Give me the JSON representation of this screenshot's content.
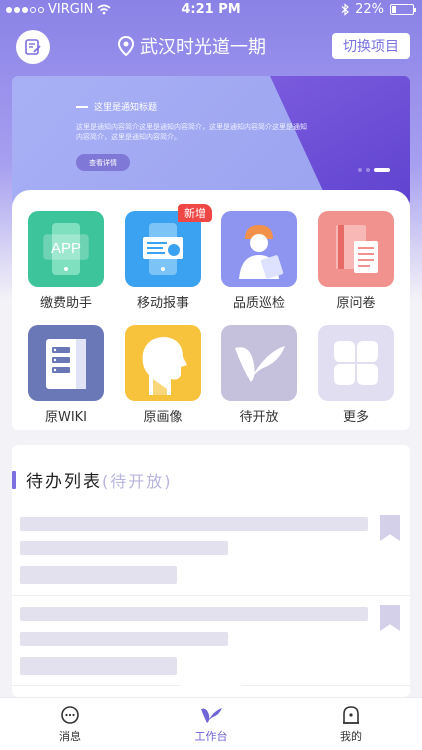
{
  "status_bar": {
    "carrier": "VIRGIN",
    "time": "4:21 PM",
    "battery": "22%"
  },
  "header": {
    "project_name": "武汉时光道一期",
    "switch_button": "切换项目"
  },
  "banner": {
    "title": "这里是通知标题",
    "text": "这里是通知内容简介这里是通知内容简介，这里是通知内容简介这里是通知内容简介，这里是通知内容简介。",
    "details_button": "查看详情",
    "pages": 3,
    "active_page": 3
  },
  "apps": [
    {
      "label": "缴费助手",
      "icon": "app-phone-icon",
      "color": "#3dc49a"
    },
    {
      "label": "移动报事",
      "icon": "mobile-report-icon",
      "color": "#3aa2f0",
      "badge": "新增"
    },
    {
      "label": "品质巡检",
      "icon": "inspector-icon",
      "color": "#8d95f0"
    },
    {
      "label": "原问卷",
      "icon": "questionnaire-icon",
      "color": "#f2928f"
    },
    {
      "label": "原WIKI",
      "icon": "wiki-book-icon",
      "color": "#6a78b8"
    },
    {
      "label": "原画像",
      "icon": "portrait-head-icon",
      "color": "#f7c33d"
    },
    {
      "label": "待开放",
      "icon": "brand-logo-icon",
      "color": "#c5c1dc"
    },
    {
      "label": "更多",
      "icon": "more-clover-icon",
      "color": "#e1def2"
    }
  ],
  "todo": {
    "title": "待办列表",
    "subtitle": "(待开放)"
  },
  "tabs": [
    {
      "label": "消息",
      "icon": "message-icon"
    },
    {
      "label": "工作台",
      "icon": "workbench-icon",
      "active": true
    },
    {
      "label": "我的",
      "icon": "profile-icon"
    }
  ],
  "colors": {
    "accent": "#7c6fe0",
    "badge": "#ef4746"
  }
}
